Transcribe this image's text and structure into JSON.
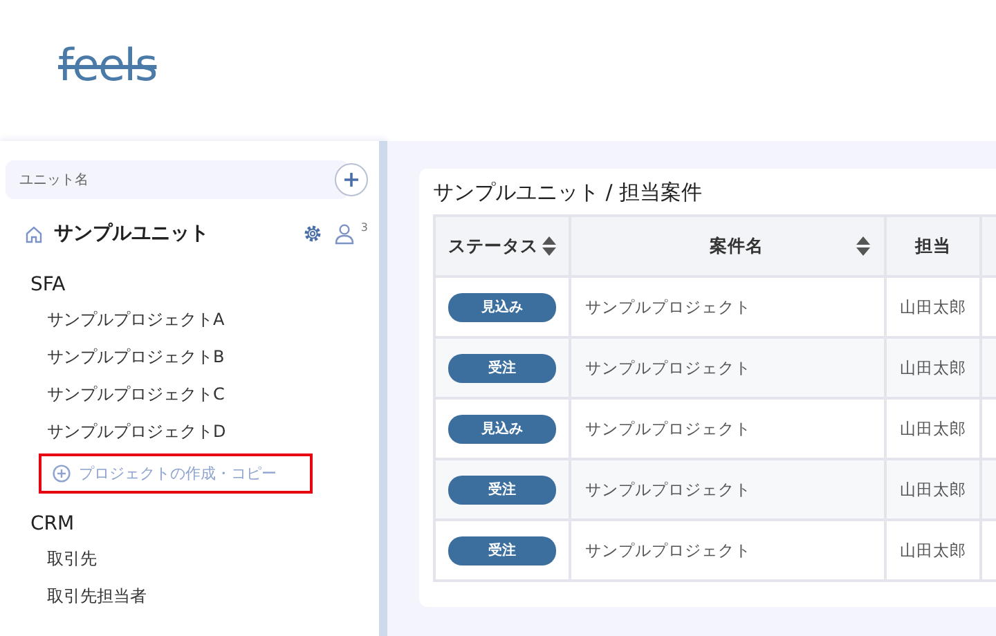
{
  "logo": {
    "text": "feels"
  },
  "sidebar": {
    "unit_search": {
      "placeholder": "ユニット名"
    },
    "unit": {
      "name": "サンプルユニット",
      "member_count": "3"
    },
    "sections": [
      {
        "title": "SFA",
        "items": [
          {
            "label": "サンプルプロジェクトA",
            "kind": "link"
          },
          {
            "label": "サンプルプロジェクトB",
            "kind": "link"
          },
          {
            "label": "サンプルプロジェクトC",
            "kind": "link"
          },
          {
            "label": "サンプルプロジェクトD",
            "kind": "link"
          },
          {
            "label": "プロジェクトの作成・コピー",
            "kind": "create",
            "highlighted": true
          }
        ]
      },
      {
        "title": "CRM",
        "items": [
          {
            "label": "取引先",
            "kind": "link"
          },
          {
            "label": "取引先担当者",
            "kind": "link"
          }
        ]
      }
    ]
  },
  "panel": {
    "title": "サンプルユニット / 担当案件",
    "table": {
      "columns": [
        {
          "label": "ステータス",
          "sortable": true
        },
        {
          "label": "案件名",
          "sortable": true
        },
        {
          "label": "担当",
          "sortable": false
        }
      ],
      "rows": [
        {
          "status": "見込み",
          "name": "サンプルプロジェクト",
          "owner": "山田太郎"
        },
        {
          "status": "受注",
          "name": "サンプルプロジェクト",
          "owner": "山田太郎"
        },
        {
          "status": "見込み",
          "name": "サンプルプロジェクト",
          "owner": "山田太郎"
        },
        {
          "status": "受注",
          "name": "サンプルプロジェクト",
          "owner": "山田太郎"
        },
        {
          "status": "受注",
          "name": "サンプルプロジェクト",
          "owner": "山田太郎"
        }
      ]
    }
  }
}
